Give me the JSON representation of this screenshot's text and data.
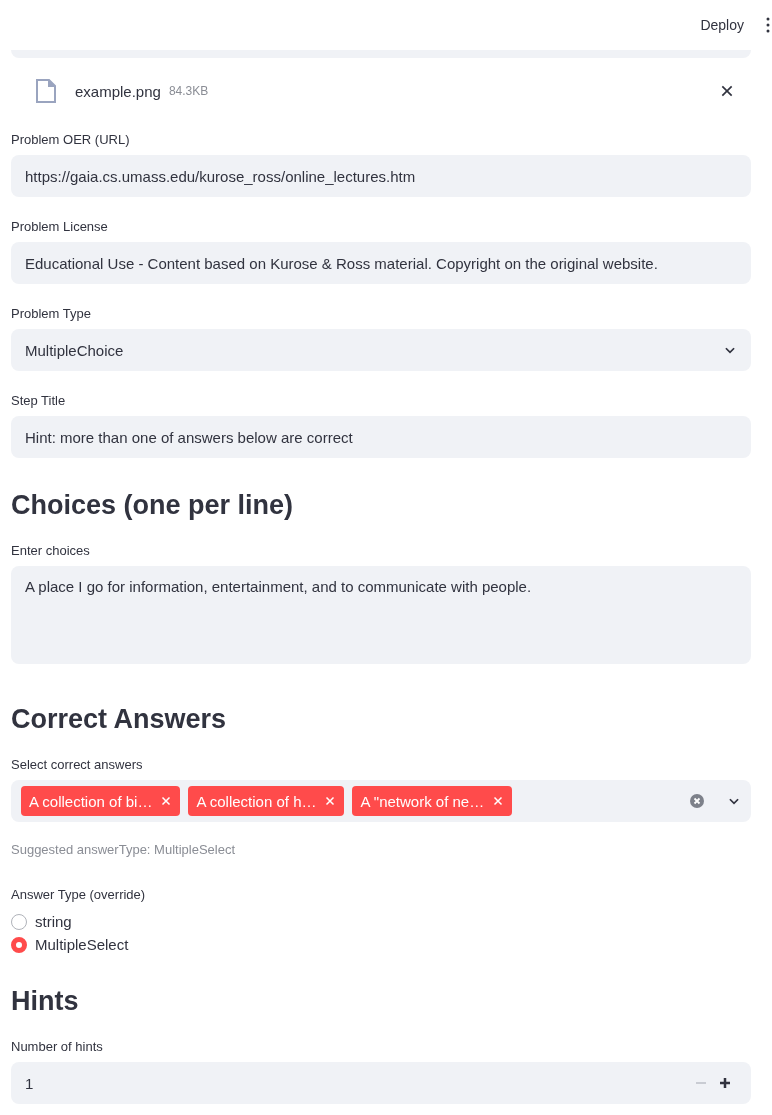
{
  "header": {
    "deploy": "Deploy"
  },
  "file": {
    "name": "example.png",
    "size": "84.3KB"
  },
  "fields": [
    {
      "label": "Problem OER (URL)",
      "value": "https://gaia.cs.umass.edu/kurose_ross/online_lectures.htm",
      "kind": "text"
    },
    {
      "label": "Problem License",
      "value": "Educational Use - Content based on Kurose & Ross material. Copyright on the original website.",
      "kind": "text"
    },
    {
      "label": "Problem Type",
      "value": "MultipleChoice",
      "kind": "select"
    },
    {
      "label": "Step Title",
      "value": "Hint: more than one of answers below are correct",
      "kind": "text"
    }
  ],
  "choices": {
    "heading": "Choices (one per line)",
    "label": "Enter choices",
    "value": "A place I go for information, entertainment, and to communicate with people."
  },
  "answers": {
    "heading": "Correct Answers",
    "label": "Select correct answers",
    "tags": [
      "A collection of bi…",
      "A collection of h…",
      "A \"network of ne…"
    ],
    "caption": "Suggested answerType: MultipleSelect"
  },
  "answer_type": {
    "label": "Answer Type (override)",
    "options": [
      {
        "label": "string",
        "selected": false
      },
      {
        "label": "MultipleSelect",
        "selected": true
      }
    ]
  },
  "hints": {
    "heading": "Hints",
    "label": "Number of hints",
    "value": "1"
  }
}
